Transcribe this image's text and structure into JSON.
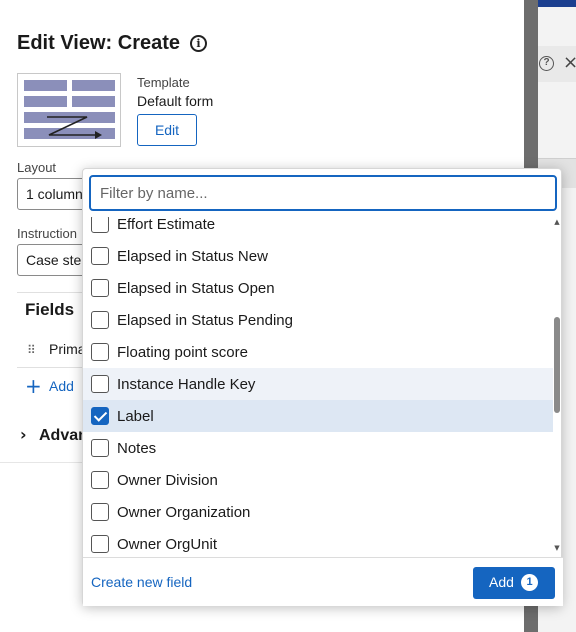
{
  "panel": {
    "title": "Edit View: Create",
    "info_icon": "info-icon",
    "template": {
      "label": "Template",
      "value": "Default form",
      "edit_label": "Edit"
    },
    "layout": {
      "label": "Layout",
      "value": "1 column"
    },
    "instructions": {
      "label": "Instruction",
      "value": "Case ste"
    },
    "fields_heading": "Fields",
    "field_row": "Prima",
    "add_link": "Add",
    "advanced_label": "Advan"
  },
  "dropdown": {
    "filter_placeholder": "Filter by name...",
    "items": [
      {
        "label": "Effort Estimate",
        "checked": false
      },
      {
        "label": "Elapsed in Status New",
        "checked": false
      },
      {
        "label": "Elapsed in Status Open",
        "checked": false
      },
      {
        "label": "Elapsed in Status Pending",
        "checked": false
      },
      {
        "label": "Floating point score",
        "checked": false
      },
      {
        "label": "Instance Handle Key",
        "checked": false
      },
      {
        "label": "Label",
        "checked": true
      },
      {
        "label": "Notes",
        "checked": false
      },
      {
        "label": "Owner Division",
        "checked": false
      },
      {
        "label": "Owner Organization",
        "checked": false
      },
      {
        "label": "Owner OrgUnit",
        "checked": false
      }
    ],
    "create_new_label": "Create new field",
    "add_label": "Add",
    "add_count": "1"
  },
  "colors": {
    "accent": "#1565c0",
    "selected_row": "#dde7f3",
    "hover_row": "#eef2f8"
  }
}
